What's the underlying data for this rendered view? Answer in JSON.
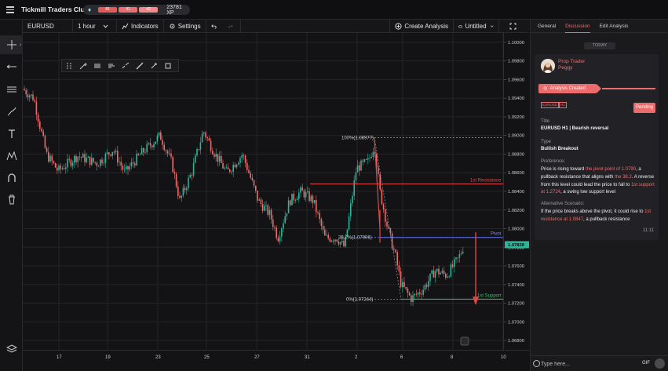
{
  "app": {
    "title": "Tickmill Traders Club",
    "xp_segments": [
      "45",
      "41",
      "42"
    ],
    "xp_total": "23781 XP"
  },
  "toolbar": {
    "symbol": "EURUSD",
    "interval": "1 hour",
    "indicators_label": "Indicators",
    "settings_label": "Settings",
    "create_analysis_label": "Create Analysis",
    "layout_name": "Untitled"
  },
  "left_tools": [
    "crosshair-icon",
    "horizontal-line-icon",
    "channel-icon",
    "brush-icon",
    "text-icon",
    "pattern-icon",
    "magnet-icon",
    "trash-icon",
    "layers-icon"
  ],
  "draw_toolbar": [
    "drag-handle-icon",
    "brush-icon",
    "style-icon",
    "style-icon",
    "line-style-icon",
    "line-width-icon",
    "settings-icon",
    "box-icon"
  ],
  "price_axis": {
    "ticks": [
      "1.10000",
      "1.09800",
      "1.09600",
      "1.09400",
      "1.09200",
      "1.09000",
      "1.08800",
      "1.08600",
      "1.08400",
      "1.08200",
      "1.08000",
      "1.07800",
      "1.07600",
      "1.07400",
      "1.07200",
      "1.07000",
      "1.06800"
    ],
    "current_price": "1.07828",
    "current_price_color": "#2db59a"
  },
  "time_axis": {
    "ticks": [
      "17",
      "19",
      "23",
      "25",
      "27",
      "31",
      "2",
      "6",
      "8",
      "10"
    ]
  },
  "chart_data": {
    "type": "candlestick",
    "symbol": "EURUSD",
    "interval": "1 hour",
    "up_color": "#2db59a",
    "down_color": "#ea6c6c",
    "y_range": [
      1.067,
      1.101
    ],
    "annotations": {
      "fib_100": "100%(1.08977)",
      "fib_382": "38.2%(1.07906)",
      "fib_0": "0%(1.07244)",
      "resistance": "1st Resistance",
      "pivot": "Pivot",
      "support": "1st Support"
    },
    "levels": {
      "fib_100": 1.08977,
      "fib_382": 1.07906,
      "fib_0": 1.07244,
      "resistance": 1.0848,
      "pivot": 1.07906,
      "support": 1.07244
    }
  },
  "panel": {
    "tabs": [
      "General",
      "Discussion",
      "Edit Analysis"
    ],
    "active_tab": "Discussion",
    "today": "TODAY",
    "author_line1": "Prop Trader",
    "author_line2": "Peggy",
    "analysis_created": "Analysis Created",
    "tags": [
      "EURUSD",
      "H1"
    ],
    "status": "Pending",
    "title_label": "Title",
    "title_value": "EURUSD H1 | Bearish reversal",
    "type_label": "Type",
    "type_value": "Bullish Breakout",
    "preference_label": "Preference:",
    "preference_parts": [
      "Price is rising toward ",
      "the pivot point of 1.0790",
      ", a pullback resistance that aligns with ",
      "the 38.2",
      ". A reverse from this level could lead the price to fall to ",
      "1st support at 1.2724",
      ", a swing low support level"
    ],
    "alternative_label": "Alternative Scenario:",
    "alternative_parts": [
      "If the price breaks above the pivot, it could rise to ",
      "1st resistance at 1.0847",
      ", a pullback resistance"
    ],
    "timestamp": "11:11",
    "message_placeholder": "Type here...",
    "gif_label": "GIF"
  }
}
